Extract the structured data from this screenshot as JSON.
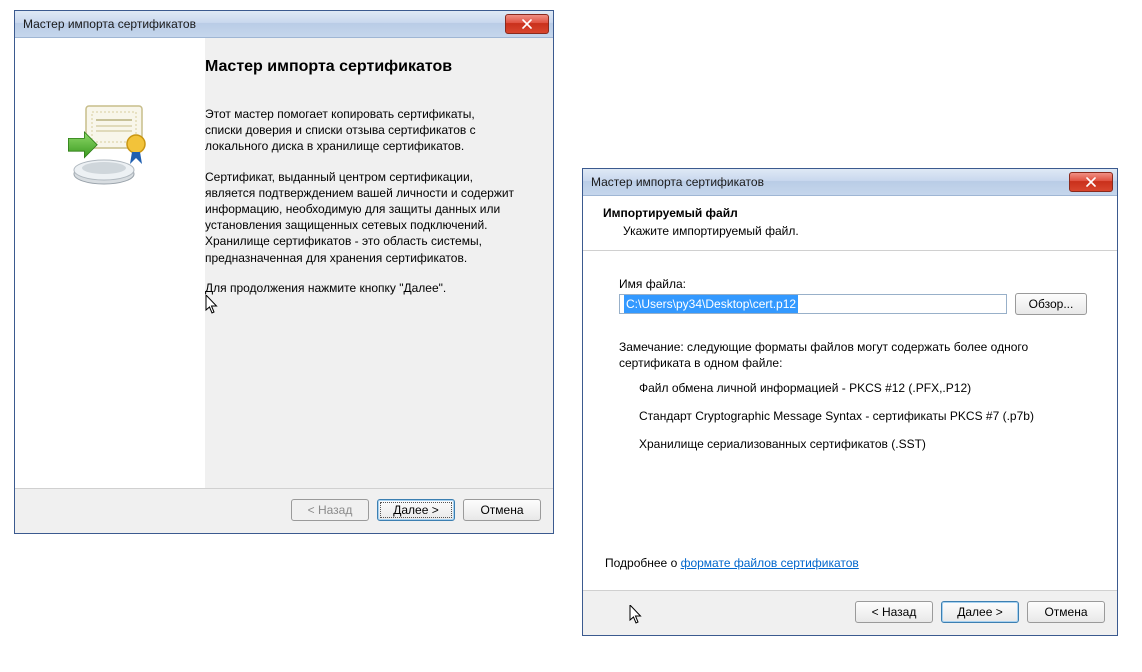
{
  "window1": {
    "title": "Мастер импорта сертификатов",
    "heading": "Мастер импорта сертификатов",
    "para1": "Этот мастер помогает копировать сертификаты, списки доверия и списки отзыва сертификатов с локального диска в хранилище сертификатов.",
    "para2": "Сертификат, выданный центром сертификации, является подтверждением вашей личности и содержит информацию, необходимую для защиты данных или установления защищенных сетевых подключений. Хранилище сертификатов - это область системы, предназначенная для хранения сертификатов.",
    "para3": "Для продолжения нажмите кнопку \"Далее\".",
    "back": "< Назад",
    "next": "Далее >",
    "cancel": "Отмена"
  },
  "window2": {
    "title": "Мастер импорта сертификатов",
    "header_title": "Импортируемый файл",
    "header_sub": "Укажите импортируемый файл.",
    "filename_label": "Имя файла:",
    "filename_value": "C:\\Users\\py34\\Desktop\\cert.p12",
    "browse": "Обзор...",
    "note": "Замечание: следующие форматы файлов могут содержать более одного сертификата в одном файле:",
    "format1": "Файл обмена личной информацией - PKCS #12 (.PFX,.P12)",
    "format2": "Стандарт Cryptographic Message Syntax - сертификаты PKCS #7 (.p7b)",
    "format3": "Хранилище сериализованных сертификатов (.SST)",
    "moreinfo_prefix": "Подробнее о ",
    "moreinfo_link": "формате файлов сертификатов",
    "back": "< Назад",
    "next": "Далее >",
    "cancel": "Отмена"
  }
}
